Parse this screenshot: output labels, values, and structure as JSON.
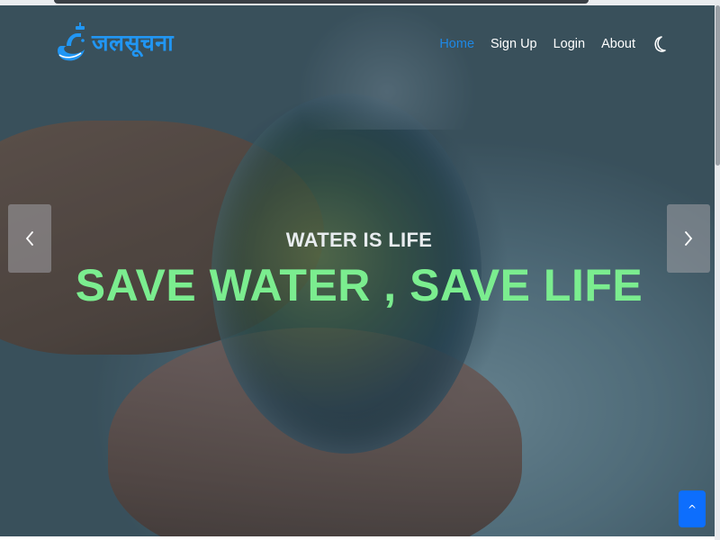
{
  "brand": {
    "name": "जलसूचना",
    "icon": "swan-faucet-logo-icon",
    "color": "#2196f3"
  },
  "nav": {
    "items": [
      {
        "label": "Home",
        "active": true
      },
      {
        "label": "Sign Up",
        "active": false
      },
      {
        "label": "Login",
        "active": false
      },
      {
        "label": "About",
        "active": false
      }
    ],
    "theme_toggle_icon": "moon-icon",
    "active_color": "#1e88e5"
  },
  "carousel": {
    "subtitle": "WATER IS LIFE",
    "title": "SAVE WATER , SAVE LIFE",
    "title_color": "#7bed8f",
    "prev_icon": "chevron-left-icon",
    "next_icon": "chevron-right-icon"
  },
  "back_to_top": {
    "label": "^",
    "icon": "chevron-up-icon",
    "color": "#0d6efd"
  }
}
